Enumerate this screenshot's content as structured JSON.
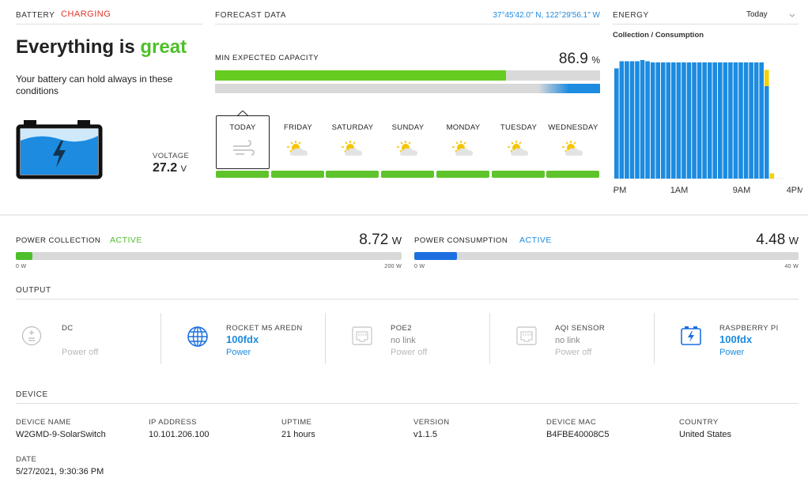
{
  "battery": {
    "section_title": "BATTERY",
    "status": "CHARGING",
    "headline_prefix": "Everything is",
    "headline_word": "great",
    "description": "Your battery can hold always in these conditions",
    "voltage_label": "VOLTAGE",
    "voltage_value": "27.2",
    "voltage_unit": "V",
    "status_color": "#e0362b",
    "icon": "battery-charging-icon"
  },
  "forecast": {
    "section_title": "FORECAST DATA",
    "coordinates": "37°45'42.0\" N, 122°29'56.1\" W",
    "min_capacity_label": "MIN EXPECTED CAPACITY",
    "min_capacity_value": "86.9",
    "min_capacity_unit": "%",
    "capacity_fraction": 0.869,
    "days": [
      {
        "name": "TODAY",
        "icon": "wind-icon"
      },
      {
        "name": "FRIDAY",
        "icon": "partly-sunny-icon"
      },
      {
        "name": "SATURDAY",
        "icon": "partly-sunny-icon"
      },
      {
        "name": "SUNDAY",
        "icon": "partly-sunny-icon"
      },
      {
        "name": "MONDAY",
        "icon": "partly-sunny-icon"
      },
      {
        "name": "TUESDAY",
        "icon": "partly-sunny-icon"
      },
      {
        "name": "WEDNESDAY",
        "icon": "partly-sunny-icon"
      }
    ]
  },
  "energy": {
    "section_title": "ENERGY",
    "range_select": "Today",
    "subtitle": "Collection / Consumption",
    "x_labels": [
      "5PM",
      "1AM",
      "9AM",
      "4PM"
    ]
  },
  "chart_data": {
    "type": "bar",
    "title": "Collection / Consumption",
    "series": [
      {
        "color": "#1c8be0",
        "values": [
          0.93,
          0.99,
          0.99,
          0.99,
          0.99,
          1.0,
          0.99,
          0.98,
          0.98,
          0.98,
          0.98,
          0.98,
          0.98,
          0.98,
          0.98,
          0.98,
          0.98,
          0.98,
          0.98,
          0.98,
          0.98,
          0.98,
          0.98,
          0.98,
          0.98,
          0.98,
          0.98,
          0.98,
          0.98,
          0.78,
          0.0
        ]
      },
      {
        "color": "#f5d000",
        "values": [
          0,
          0,
          0,
          0,
          0,
          0,
          0,
          0,
          0,
          0,
          0,
          0,
          0,
          0,
          0,
          0,
          0,
          0,
          0,
          0,
          0,
          0,
          0,
          0,
          0,
          0,
          0,
          0,
          0,
          0.25,
          0.08
        ]
      }
    ],
    "x_tick_labels": [
      "5PM",
      "1AM",
      "9AM",
      "4PM"
    ]
  },
  "power_collection": {
    "label": "POWER COLLECTION",
    "status": "ACTIVE",
    "value": "8.72",
    "unit": "W",
    "min_label": "0 W",
    "max_label": "200 W",
    "fraction": 0.044,
    "color": "#4fbf2a"
  },
  "power_consumption": {
    "label": "POWER CONSUMPTION",
    "status": "ACTIVE",
    "value": "4.48",
    "unit": "W",
    "min_label": "0 W",
    "max_label": "40 W",
    "fraction": 0.112,
    "color": "#1c6fe0"
  },
  "output": {
    "section_title": "OUTPUT",
    "ports": [
      {
        "name": "DC",
        "line2": "",
        "line3": "Power off",
        "icon": "dc-plus-minus-icon"
      },
      {
        "name": "ROCKET M5 AREDN",
        "line2": "100fdx",
        "line3": "Power",
        "icon": "globe-icon"
      },
      {
        "name": "POE2",
        "line2": "no link",
        "line3": "Power off",
        "icon": "ethernet-port-icon"
      },
      {
        "name": "AQI SENSOR",
        "line2": "no link",
        "line3": "Power off",
        "icon": "ethernet-port-icon"
      },
      {
        "name": "RASPBERRY PI",
        "line2": "100fdx",
        "line3": "Power",
        "icon": "battery-charge-port-icon"
      }
    ]
  },
  "device": {
    "section_title": "DEVICE",
    "fields": [
      {
        "label": "DEVICE NAME",
        "value": "W2GMD-9-SolarSwitch"
      },
      {
        "label": "IP ADDRESS",
        "value": "10.101.206.100"
      },
      {
        "label": "UPTIME",
        "value": "21 hours"
      },
      {
        "label": "VERSION",
        "value": "v1.1.5"
      },
      {
        "label": "DEVICE MAC",
        "value": "B4FBE40008C5"
      },
      {
        "label": "COUNTRY",
        "value": "United States"
      }
    ],
    "date_label": "DATE",
    "date_value": "5/27/2021, 9:30:36 PM"
  }
}
